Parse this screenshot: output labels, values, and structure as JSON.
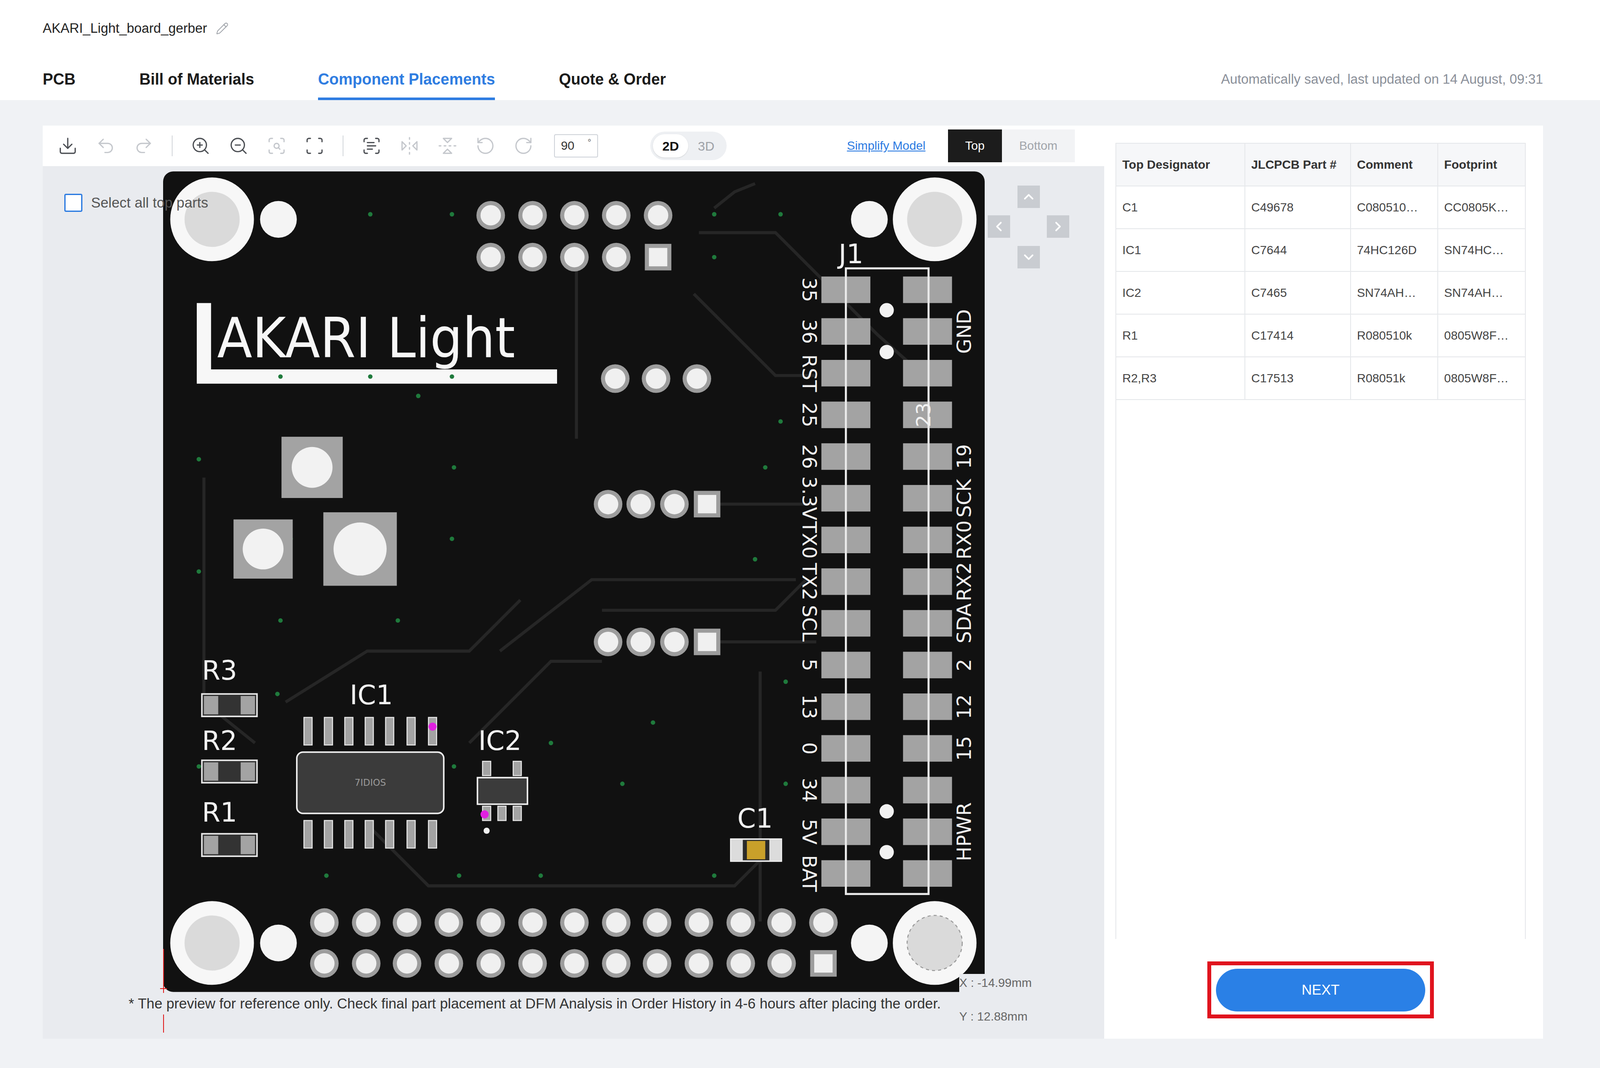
{
  "document": {
    "name": "AKARI_Light_board_gerber"
  },
  "tabs": [
    {
      "label": "PCB",
      "selected": false
    },
    {
      "label": "Bill of Materials",
      "selected": false
    },
    {
      "label": "Component Placements",
      "selected": true
    },
    {
      "label": "Quote & Order",
      "selected": false
    }
  ],
  "save_status": "Automatically saved, last updated on 14 August, 09:31",
  "toolbar": {
    "tools": [
      {
        "disabled": false
      },
      {
        "disabled": true
      },
      {
        "disabled": true
      },
      {
        "disabled": false
      },
      {
        "disabled": false
      },
      {
        "disabled": true
      },
      {
        "disabled": false
      },
      {
        "disabled": false
      },
      {
        "disabled": true
      },
      {
        "disabled": true
      },
      {
        "disabled": true
      },
      {
        "disabled": true
      }
    ],
    "rotation": {
      "value": "90",
      "unit": "°"
    },
    "view_modes": [
      {
        "label": "2D",
        "selected": true
      },
      {
        "label": "3D",
        "selected": false
      }
    ],
    "simplify_link": "Simplify Model",
    "sides": [
      {
        "label": "Top",
        "selected": true
      },
      {
        "label": "Bottom",
        "selected": false
      }
    ]
  },
  "canvas": {
    "select_all": {
      "label": "Select all top parts",
      "checked": false
    },
    "board": {
      "title": "AKARI Light",
      "connector": {
        "label": "J1",
        "inner_label": "23",
        "left_pins": [
          "35",
          "36",
          "RST",
          "25",
          "26",
          "3.3V",
          "TX0",
          "TX2",
          "SCL",
          "5",
          "13",
          "0",
          "34",
          "5V",
          "BAT"
        ],
        "right_pins": [
          "",
          "GND",
          "",
          "",
          "19",
          "SCK",
          "RX0",
          "RX2",
          "SDA",
          "2",
          "12",
          "15",
          "",
          "HPWR",
          ""
        ]
      },
      "parts": [
        {
          "designator": "R3",
          "kind": "resistor"
        },
        {
          "designator": "R2",
          "kind": "resistor"
        },
        {
          "designator": "R1",
          "kind": "resistor"
        },
        {
          "designator": "IC1",
          "kind": "soic",
          "marking": "7IDIOS"
        },
        {
          "designator": "IC2",
          "kind": "sot"
        },
        {
          "designator": "C1",
          "kind": "capacitor"
        }
      ]
    },
    "note": "* The preview for reference only. Check final part placement at DFM Analysis in Order History in 4-6 hours after placing the order.",
    "cursor": {
      "x": "X : -14.99mm",
      "y": "Y : 12.88mm"
    }
  },
  "table": {
    "columns": [
      "Top Designator",
      "JLCPCB Part #",
      "Comment",
      "Footprint"
    ],
    "rows": [
      [
        "C1",
        "C49678",
        "C080510…",
        "CC0805K…"
      ],
      [
        "IC1",
        "C7644",
        "74HC126D",
        "SN74HC…"
      ],
      [
        "IC2",
        "C7465",
        "SN74AH…",
        "SN74AH…"
      ],
      [
        "R1",
        "C17414",
        "R080510k",
        "0805W8F…"
      ],
      [
        "R2,R3",
        "C17513",
        "R08051k",
        "0805W8F…"
      ]
    ]
  },
  "next_button": {
    "label": "NEXT",
    "highlighted": true
  }
}
